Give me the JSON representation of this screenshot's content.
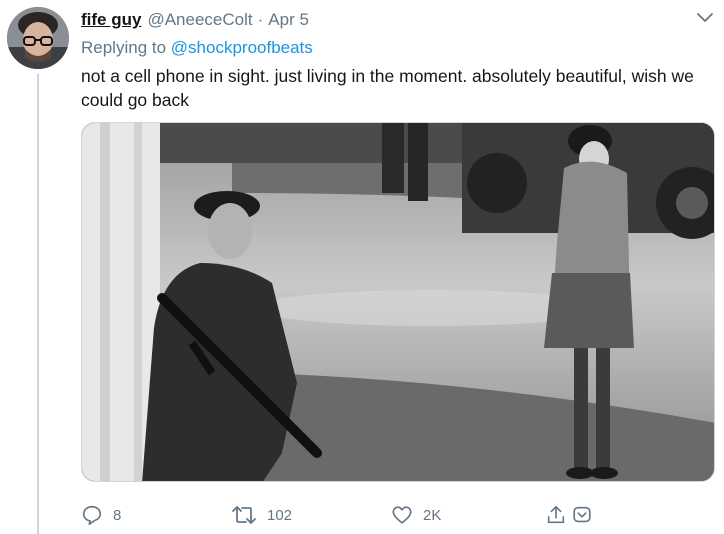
{
  "tweet": {
    "display_name": "fife guy",
    "handle": "@AneeceColt",
    "separator": "·",
    "date": "Apr 5",
    "replying_prefix": "Replying to ",
    "replying_to": "@shockproofbeats",
    "text": "not a cell phone in sight. just living in the moment. absolutely beautiful, wish we could go back"
  },
  "actions": {
    "reply_count": "8",
    "retweet_count": "102",
    "like_count": "2K"
  },
  "icons": {
    "more": "chevron-down-icon",
    "reply": "reply-icon",
    "retweet": "retweet-icon",
    "like": "heart-icon",
    "share": "share-icon",
    "bookmark": "bookmark-icon"
  },
  "colors": {
    "link": "#1b95e0",
    "muted": "#657786",
    "text": "#14171a",
    "thread_line": "#ccd6dd"
  }
}
